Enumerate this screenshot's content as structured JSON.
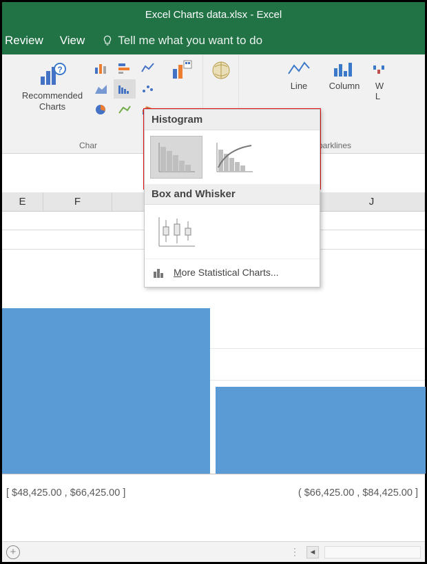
{
  "titlebar": "Excel Charts data.xlsx - Excel",
  "tabs": {
    "review": "Review",
    "view": "View",
    "tell_me": "Tell me what you want to do"
  },
  "ribbon": {
    "recommended": "Recommended\nCharts",
    "group_charts": "Char",
    "line": "Line",
    "column": "Column",
    "wl_initial": "W",
    "wl_cut": "L",
    "group_sparklines": "Sparklines"
  },
  "popup": {
    "histogram": "Histogram",
    "box": "Box and Whisker",
    "more_u": "M",
    "more_rest": "ore Statistical Charts..."
  },
  "columns": {
    "E": "E",
    "F": "F",
    "J": "J"
  },
  "axis": {
    "left": "[ $48,425.00 ,  $66,425.00 ]",
    "right": "( $66,425.00 ,  $84,425.00 ]"
  },
  "chart_data": {
    "type": "bar",
    "title": "",
    "xlabel": "",
    "ylabel": "",
    "note": "Only two partial bars and bin labels are visible in the cropped screenshot; heights are not readable from the visible portion.",
    "categories": [
      "[ $48,425.00 , $66,425.00 ]",
      "( $66,425.00 , $84,425.00 ]"
    ],
    "values": [
      null,
      null
    ]
  }
}
